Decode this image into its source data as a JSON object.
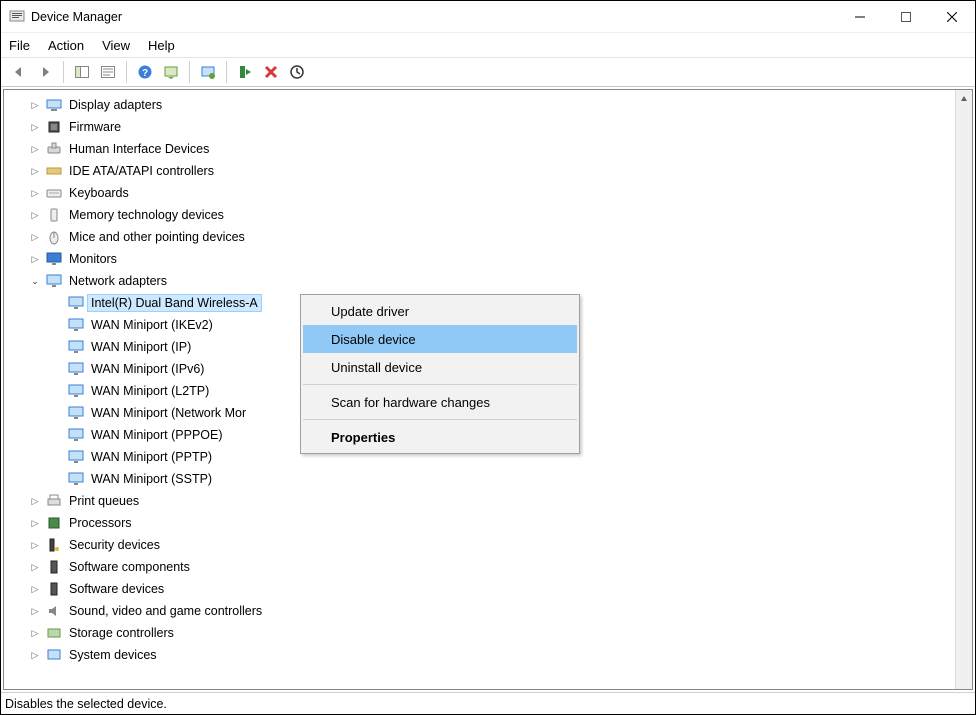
{
  "title": "Device Manager",
  "menubar": {
    "file": "File",
    "action": "Action",
    "view": "View",
    "help": "Help"
  },
  "statusbar": "Disables the selected device.",
  "tree": {
    "display_adapters": "Display adapters",
    "firmware": "Firmware",
    "hid": "Human Interface Devices",
    "ide": "IDE ATA/ATAPI controllers",
    "keyboards": "Keyboards",
    "memory_tech": "Memory technology devices",
    "mice": "Mice and other pointing devices",
    "monitors": "Monitors",
    "network_adapters": "Network adapters",
    "print_queues": "Print queues",
    "processors": "Processors",
    "security_devices": "Security devices",
    "software_components": "Software components",
    "software_devices": "Software devices",
    "sound": "Sound, video and game controllers",
    "storage_controllers": "Storage controllers",
    "system_devices": "System devices"
  },
  "network_children": {
    "intel": "Intel(R) Dual Band Wireless-A",
    "wan_ikev2": "WAN Miniport (IKEv2)",
    "wan_ip": "WAN Miniport (IP)",
    "wan_ipv6": "WAN Miniport (IPv6)",
    "wan_l2tp": "WAN Miniport (L2TP)",
    "wan_netmon": "WAN Miniport (Network Mor",
    "wan_pppoe": "WAN Miniport (PPPOE)",
    "wan_pptp": "WAN Miniport (PPTP)",
    "wan_sstp": "WAN Miniport (SSTP)"
  },
  "context_menu": {
    "update_driver": "Update driver",
    "disable_device": "Disable device",
    "uninstall_device": "Uninstall device",
    "scan_hardware": "Scan for hardware changes",
    "properties": "Properties"
  }
}
